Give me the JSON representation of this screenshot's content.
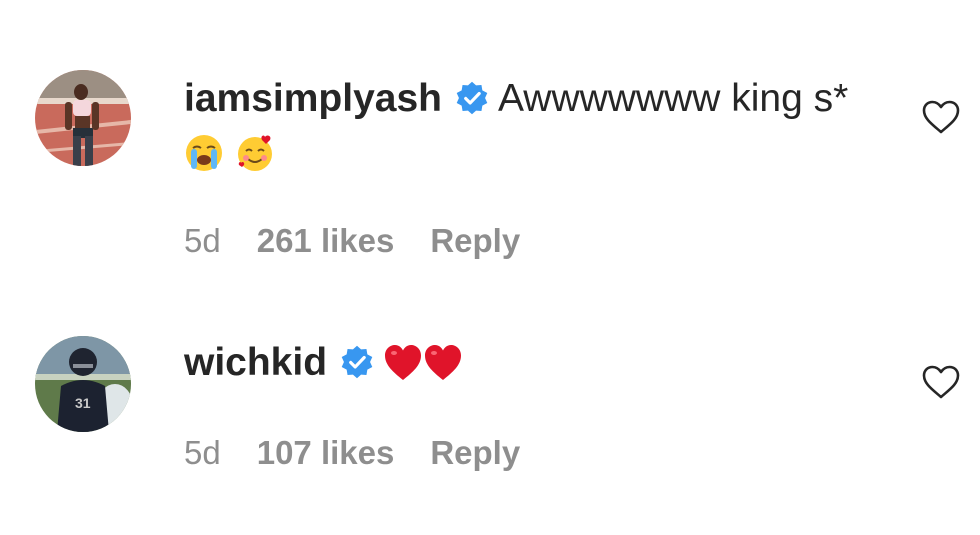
{
  "comments": [
    {
      "username": "iamsimplyash",
      "verified": true,
      "text": "Awwwwwww king s*",
      "emojis": [
        "loudly-crying-face",
        "smiling-face-with-hearts"
      ],
      "age": "5d",
      "likes": "261 likes",
      "reply_label": "Reply"
    },
    {
      "username": "wichkid",
      "verified": true,
      "text": "",
      "emojis": [
        "red-heart",
        "red-heart"
      ],
      "age": "5d",
      "likes": "107 likes",
      "reply_label": "Reply"
    }
  ],
  "colors": {
    "text": "#262626",
    "meta": "#8e8e8e",
    "verified": "#3897f0",
    "heart_emoji": "#e0142a"
  }
}
